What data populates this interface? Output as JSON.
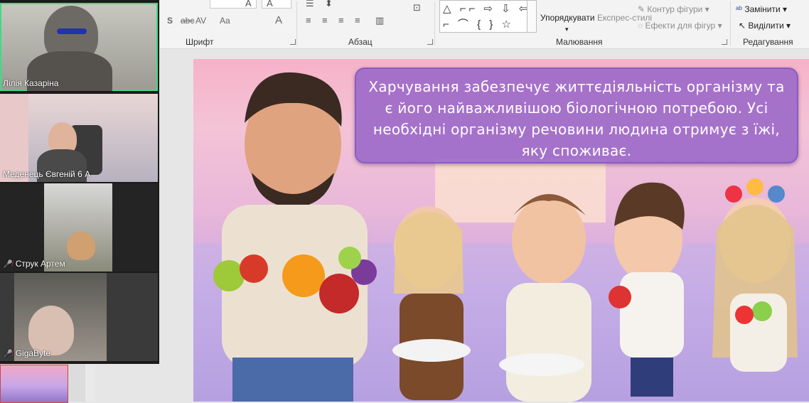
{
  "ribbon": {
    "groups": {
      "font": "Шрифт",
      "paragraph": "Абзац",
      "drawing": "Малювання",
      "editing": "Редагування"
    },
    "font_buttons": [
      "S",
      "abc",
      "AV",
      "Aa",
      "A"
    ],
    "arrange_label": "Упорядкувати",
    "express_styles_label": "Експрес-стилі",
    "shape_outline_label": "Контур фігури",
    "shape_effects_label": "Ефекти для фігур",
    "replace_label": "Замінити",
    "select_label": "Виділити"
  },
  "participants": [
    {
      "name": "Лілія Казаріна",
      "muted": false,
      "active": true
    },
    {
      "name": "Меденець Євгеній 6 А",
      "muted": false,
      "active": false
    },
    {
      "name": "Струк Артем",
      "muted": true,
      "active": false
    },
    {
      "name": "GigaByte",
      "muted": true,
      "active": false
    }
  ],
  "slide": {
    "caption": "Харчування забезпечує життєдіяльність організму та є його найважливішою біологічною потребою. Усі необхідні організму речовини людина отримує з їжі, яку споживає."
  },
  "colors": {
    "active_speaker": "#3ddc84",
    "muted_mic": "#e53935",
    "caption_bg": "#9664c8"
  },
  "icons": [
    "strikethrough-icon",
    "spacing-icon",
    "case-icon",
    "font-color-icon",
    "align-left-icon",
    "align-center-icon",
    "align-right-icon",
    "justify-icon",
    "shapes-gallery-icon",
    "replace-icon",
    "select-icon",
    "mic-muted-icon"
  ]
}
